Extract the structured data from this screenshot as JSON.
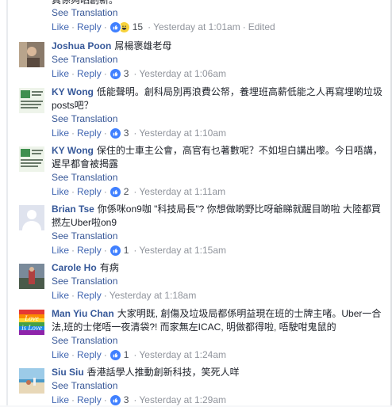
{
  "colors": {
    "link": "#365899",
    "action": "#4267b2",
    "meta": "#90949c",
    "like_blue": "#4080ff",
    "haha_yellow": "#f7d23b"
  },
  "partial": {
    "tail_text": "真係夠晒創新。",
    "see_translation": "See Translation",
    "like": "Like",
    "reply": "Reply",
    "react_count": "15",
    "reactions": [
      "like-icon",
      "haha-icon"
    ],
    "time": "Yesterday at 1:01am",
    "edited": "Edited"
  },
  "comments": [
    {
      "author": "Joshua Poon",
      "text": "屌楊褒雄老母",
      "see_translation": "See Translation",
      "like": "Like",
      "reply": "Reply",
      "react_count": "3",
      "time": "Yesterday at 1:06am",
      "avatar": "person-photo"
    },
    {
      "author": "KY Wong",
      "text": "低能聲明。創科局別再浪費公帑，養埋班高薪低能之人再寫埋啲垃圾posts吧？",
      "see_translation": "See Translation",
      "like": "Like",
      "reply": "Reply",
      "react_count": "3",
      "time": "Yesterday at 1:10am",
      "avatar": "document-thumbnail"
    },
    {
      "author": "KY Wong",
      "text": "保住的士車主公會，高官有乜著數呢？不如坦白講出嚟。今日唔講，遲早都會被揭露",
      "see_translation": "See Translation",
      "like": "Like",
      "reply": "Reply",
      "react_count": "2",
      "time": "Yesterday at 1:11am",
      "avatar": "document-thumbnail"
    },
    {
      "author": "Brian Tse",
      "text": "你係咪on9咖 \"科技局長\"? 你想做啲野比呀爺睇就醒目啲啦 大陸都買撚左Uber啦on9",
      "see_translation": "See Translation",
      "like": "Like",
      "reply": "Reply",
      "react_count": "1",
      "time": "Yesterday at 1:15am",
      "avatar": "default-silhouette"
    },
    {
      "author": "Carole Ho",
      "text": "有病",
      "see_translation": "See Translation",
      "like": "Like",
      "reply": "Reply",
      "react_count": "",
      "time": "Yesterday at 1:18am",
      "avatar": "landscape-photo"
    },
    {
      "author": "Man Yiu Chan",
      "text": "大家明既, 創傷及垃圾局都係明益現在班的士牌主啫。Uber一合法,班的士佬唔一夜清袋?! 而家無左ICAC, 明做都得啦, 唔駛咁鬼鼠的",
      "see_translation": "See Translation",
      "like": "Like",
      "reply": "Reply",
      "react_count": "1",
      "time": "Yesterday at 1:24am",
      "avatar": "love-rainbow"
    },
    {
      "author": "Siu Siu",
      "text": "香港話學人推動創新科技，笑死人咩",
      "see_translation": "See Translation",
      "like": "Like",
      "reply": "Reply",
      "react_count": "3",
      "time": "Yesterday at 1:29am",
      "avatar": "beach-photo"
    }
  ]
}
